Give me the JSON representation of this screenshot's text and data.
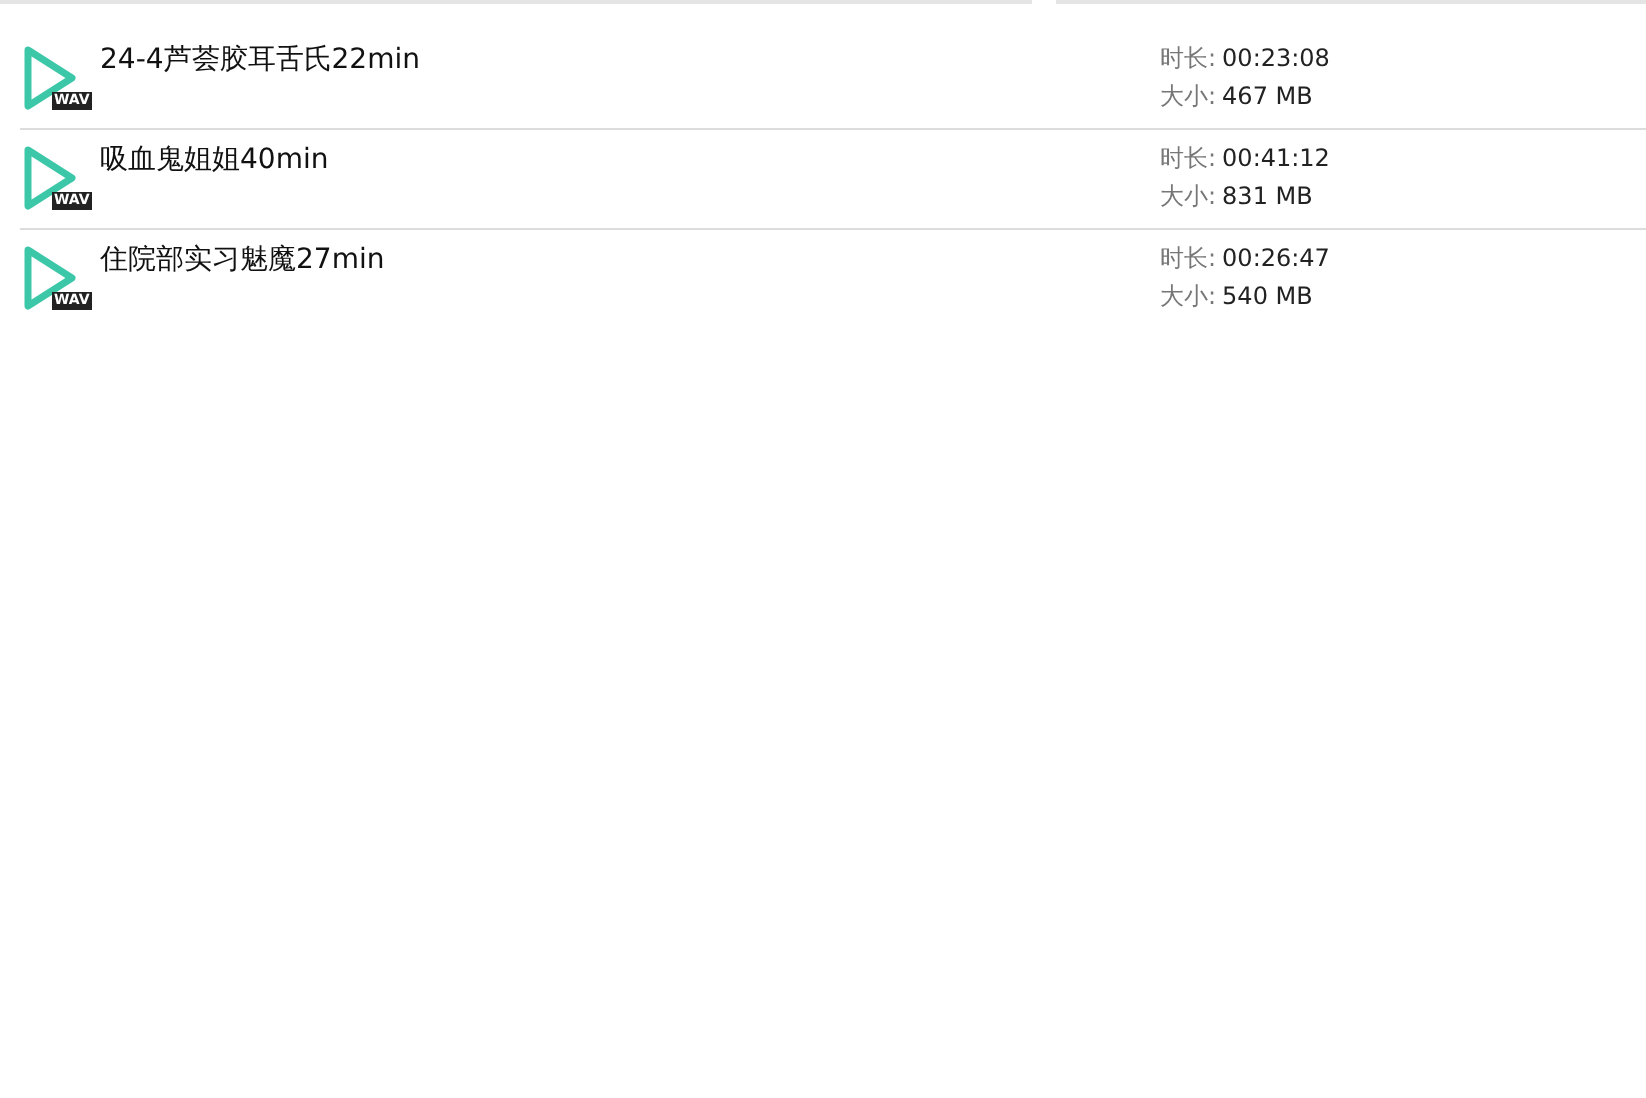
{
  "files": [
    {
      "title": "24-4芦荟胶耳舌氏22min",
      "badge": "WAV",
      "duration_label": "时长:",
      "duration": "00:23:08",
      "size_label": "大小:",
      "size": "467 MB"
    },
    {
      "title": "吸血鬼姐姐40min",
      "badge": "WAV",
      "duration_label": "时长:",
      "duration": "00:41:12",
      "size_label": "大小:",
      "size": "831 MB"
    },
    {
      "title": "住院部实习魅魔27min",
      "badge": "WAV",
      "duration_label": "时长:",
      "duration": "00:26:47",
      "size_label": "大小:",
      "size": "540 MB"
    }
  ]
}
